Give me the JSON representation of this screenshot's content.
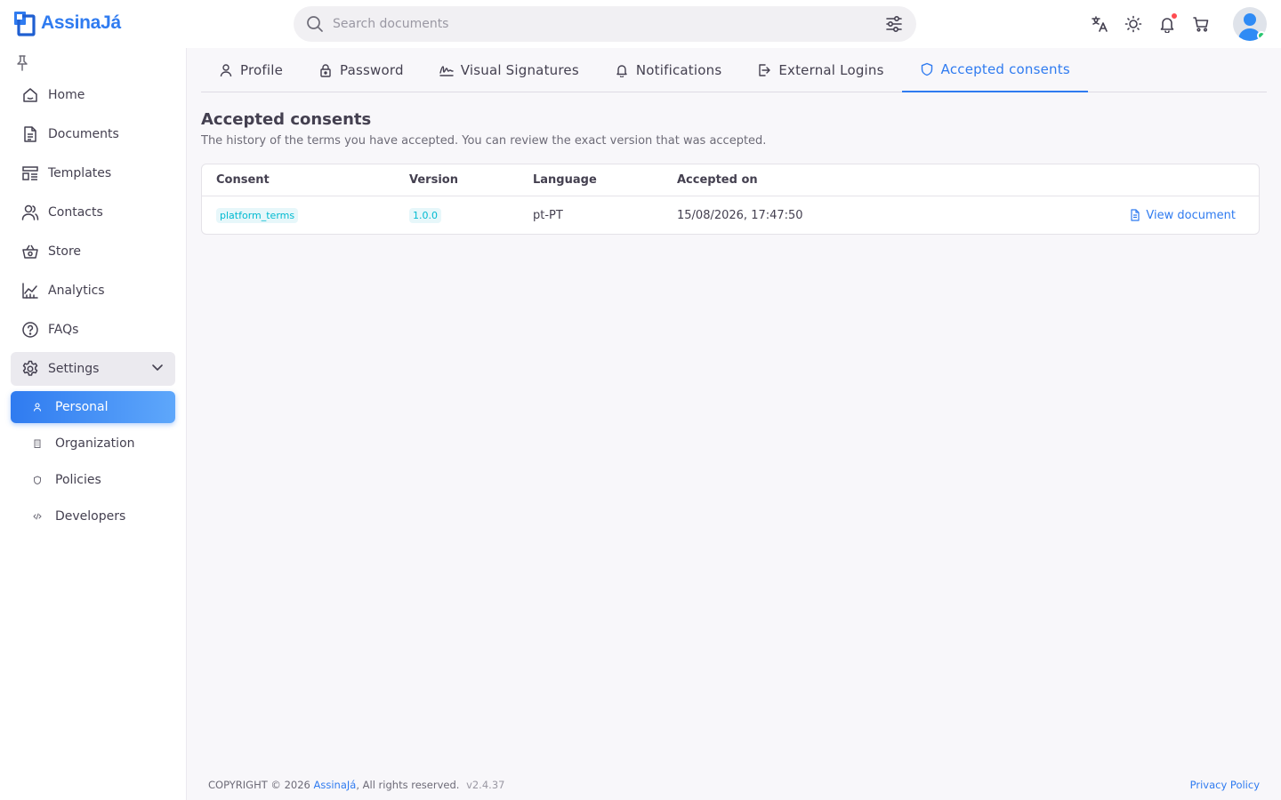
{
  "brand": {
    "name": "AssinaJá",
    "color": "#2f7bf0"
  },
  "search": {
    "placeholder": "Search documents"
  },
  "header_icons": [
    "translate-icon",
    "sun-icon",
    "bell-icon",
    "cart-icon"
  ],
  "sidebar": {
    "items": [
      {
        "label": "Home",
        "icon": "home-icon"
      },
      {
        "label": "Documents",
        "icon": "document-icon"
      },
      {
        "label": "Templates",
        "icon": "template-icon"
      },
      {
        "label": "Contacts",
        "icon": "contacts-icon"
      },
      {
        "label": "Store",
        "icon": "basket-icon"
      },
      {
        "label": "Analytics",
        "icon": "chart-icon"
      },
      {
        "label": "FAQs",
        "icon": "help-icon"
      }
    ],
    "settings": {
      "label": "Settings",
      "icon": "gear-icon",
      "expanded": true
    },
    "sub_items": [
      {
        "label": "Personal",
        "icon": "user-icon",
        "active": true
      },
      {
        "label": "Organization",
        "icon": "building-icon",
        "active": false
      },
      {
        "label": "Policies",
        "icon": "policy-icon",
        "active": false
      },
      {
        "label": "Developers",
        "icon": "code-icon",
        "active": false
      }
    ]
  },
  "tabs": [
    {
      "label": "Profile",
      "icon": "user-icon",
      "active": false
    },
    {
      "label": "Password",
      "icon": "lock-icon",
      "active": false
    },
    {
      "label": "Visual Signatures",
      "icon": "signature-icon",
      "active": false
    },
    {
      "label": "Notifications",
      "icon": "bell-icon",
      "active": false
    },
    {
      "label": "External Logins",
      "icon": "login-icon",
      "active": false
    },
    {
      "label": "Accepted consents",
      "icon": "shield-icon",
      "active": true
    }
  ],
  "page": {
    "title": "Accepted consents",
    "subtitle": "The history of the terms you have accepted. You can review the exact version that was accepted."
  },
  "table": {
    "columns": [
      "Consent",
      "Version",
      "Language",
      "Accepted on"
    ],
    "rows": [
      {
        "consent": "platform_terms",
        "version": "1.0.0",
        "language": "pt-PT",
        "accepted_on": "15/08/2026, 17:47:50",
        "action": "View document"
      }
    ]
  },
  "footer": {
    "copyright": "COPYRIGHT © 2026",
    "brand": "AssinaJá",
    "rights": ", All rights reserved.",
    "version": "v2.4.37",
    "privacy": "Privacy Policy"
  },
  "colors": {
    "accent": "#2f7bf0",
    "chip_bg": "#e7f7fa",
    "chip_text": "#00bad1",
    "online": "#28c76f",
    "alert": "#ff4c51"
  }
}
